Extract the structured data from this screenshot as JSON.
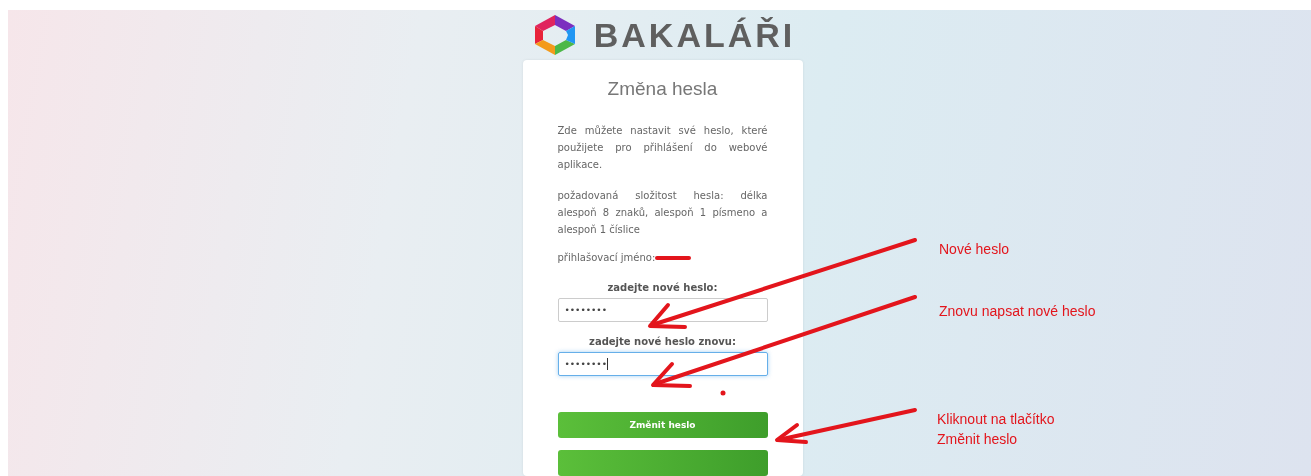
{
  "logo": {
    "text": "BAKALÁŘI"
  },
  "card": {
    "title": "Změna hesla",
    "paragraphs": [
      "Zde můžete nastavit své heslo, které použijete pro přihlášení do webové aplikace.",
      "požadovaná složitost hesla: délka alespoň 8 znaků, alespoň 1 písmeno a alespoň 1 číslice"
    ],
    "login_label": "přihlašovací jméno:",
    "username_redacted": true,
    "fields": [
      {
        "label": "zadejte nové heslo:",
        "value": "••••••••",
        "focused": false
      },
      {
        "label": "zadejte nové heslo znovu:",
        "value": "••••••••",
        "focused": true
      }
    ],
    "buttons": [
      {
        "label": "Změnit heslo",
        "kind": "full"
      },
      {
        "kind": "cut"
      }
    ]
  },
  "annotations": [
    {
      "lines": [
        "Nové heslo"
      ]
    },
    {
      "lines": [
        "Znovu napsat nové heslo"
      ]
    },
    {
      "lines": [
        "Kliknout na tlačítko",
        "Změnit heslo"
      ]
    }
  ]
}
